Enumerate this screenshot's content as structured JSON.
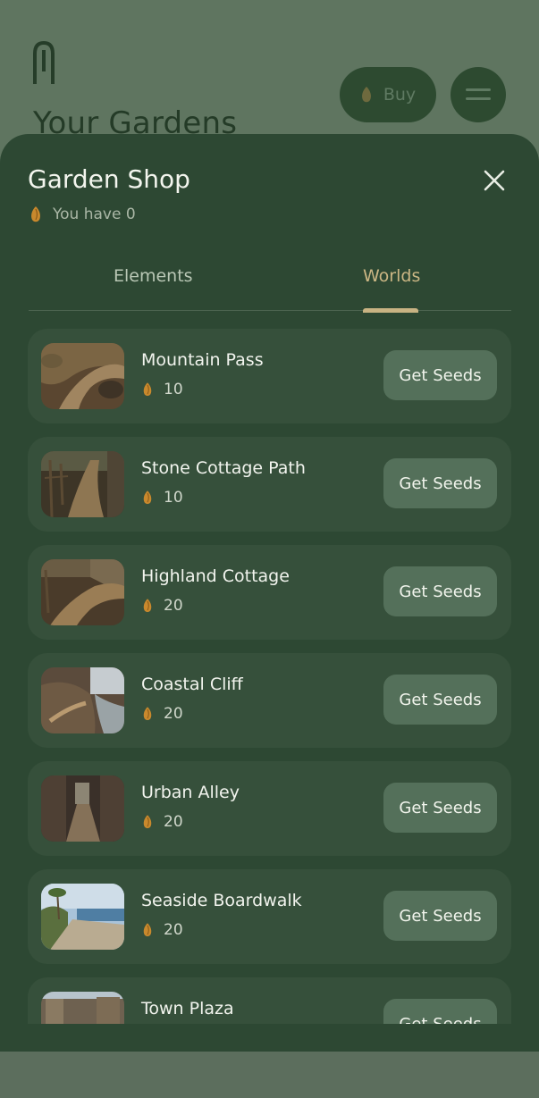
{
  "background": {
    "logo_icon": "app-logo-icon",
    "title": "Your Gardens",
    "buy_label": "Buy",
    "menu_icon": "menu-icon"
  },
  "shop": {
    "title": "Garden Shop",
    "balance_text": "You have 0",
    "tabs": [
      {
        "label": "Elements",
        "active": false
      },
      {
        "label": "Worlds",
        "active": true
      }
    ],
    "button_label": "Get Seeds",
    "items": [
      {
        "name": "Mountain Pass",
        "price": "10",
        "thumb": "mountain-path"
      },
      {
        "name": "Stone Cottage Path",
        "price": "10",
        "thumb": "fenced-path"
      },
      {
        "name": "Highland Cottage",
        "price": "20",
        "thumb": "stone-wall-path"
      },
      {
        "name": "Coastal Cliff",
        "price": "20",
        "thumb": "cliff-path"
      },
      {
        "name": "Urban Alley",
        "price": "20",
        "thumb": "alley"
      },
      {
        "name": "Seaside Boardwalk",
        "price": "20",
        "thumb": "boardwalk"
      },
      {
        "name": "Town Plaza",
        "price": "",
        "thumb": "plaza"
      }
    ]
  },
  "colors": {
    "backdrop": "#5f7560",
    "sheet": "#2d4833",
    "card": "#36503b",
    "button": "#54705a",
    "accent_tab": "#cbb684",
    "seed": "#c9892d"
  }
}
